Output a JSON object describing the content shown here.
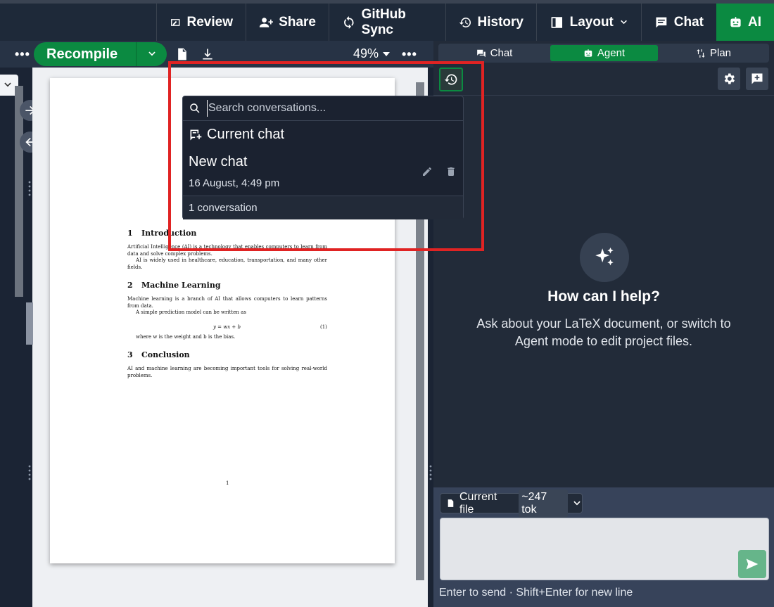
{
  "topbar": {
    "review": "Review",
    "share": "Share",
    "github_sync": "GitHub Sync",
    "history": "History",
    "layout": "Layout",
    "chat": "Chat",
    "ai": "AI"
  },
  "pdf_toolbar": {
    "more": "•••",
    "recompile": "Recompile",
    "zoom": "49%",
    "more_right": "•••"
  },
  "pdf": {
    "sections": [
      {
        "num": "1",
        "title": "Introduction"
      },
      {
        "num": "2",
        "title": "Machine Learning"
      },
      {
        "num": "3",
        "title": "Conclusion"
      }
    ],
    "p1": "Artificial Intelligence (AI) is a technology that enables computers to learn from data and solve complex problems.",
    "p1b": "AI is widely used in healthcare, education, transportation, and many other fields.",
    "p2": "Machine learning is a branch of AI that allows computers to learn patterns from data.",
    "p2b": "A simple prediction model can be written as",
    "equation": "y = wx + b",
    "equation_num": "(1)",
    "p2c": "where w is the weight and b is the bias.",
    "p3": "AI and machine learning are becoming important tools for solving real-world problems.",
    "page_number": "1"
  },
  "history_popup": {
    "search_placeholder": "Search conversations...",
    "current_chat": "Current chat",
    "conversation": {
      "title": "New chat",
      "date": "16 August, 4:49 pm"
    },
    "footer": "1 conversation"
  },
  "ai_panel": {
    "tabs": [
      {
        "label": "Chat",
        "active": false
      },
      {
        "label": "Agent",
        "active": true
      },
      {
        "label": "Plan",
        "active": false
      }
    ],
    "empty_title": "How can I help?",
    "empty_desc": "Ask about your LaTeX document, or switch to Agent mode to edit project files.",
    "file_chip": {
      "label": "Current file",
      "tokens": "~247 tok"
    },
    "hint": "Enter to send · Shift+Enter for new line"
  },
  "colors": {
    "accent_green": "#0b8a41",
    "highlight_red": "#e02323",
    "panel_bg": "#222b39"
  }
}
